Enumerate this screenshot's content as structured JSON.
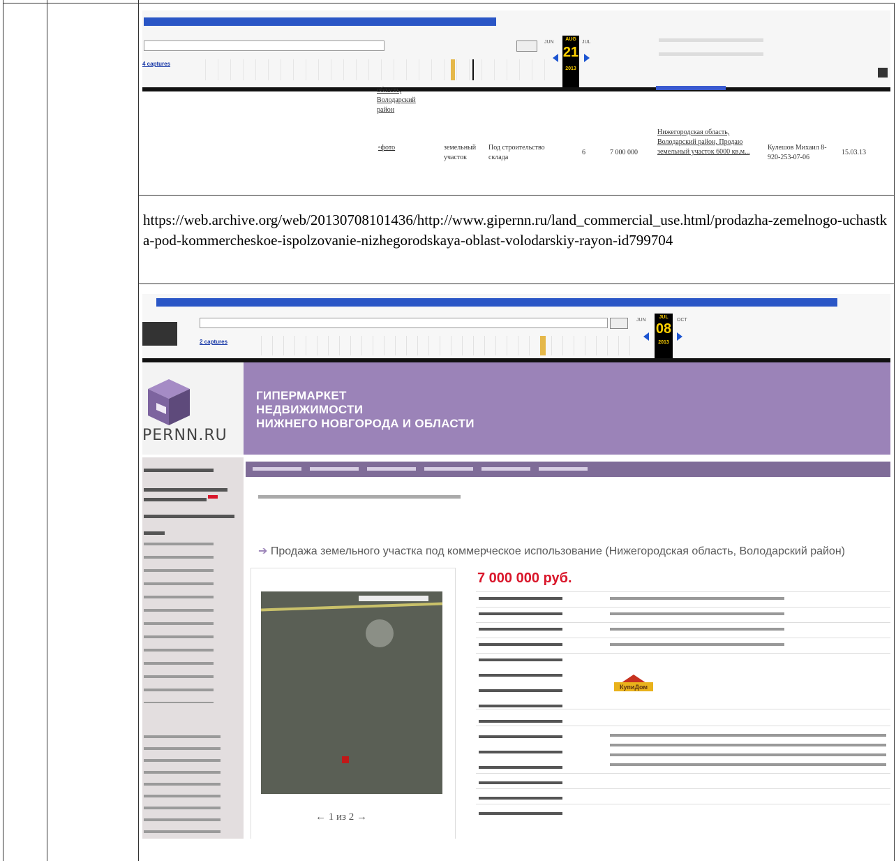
{
  "url_text": "https://web.archive.org/web/20130708101436/http://www.gipernn.ru/land_commercial_use.html/prodazha-zemelnogo-uchastka-pod-kommercheskoe-ispolzovanie-nizhegorodskaya-oblast-volodarskiy-rayon-id799704",
  "shot1": {
    "captures_label": "4 captures",
    "cal_left_month": "JUN",
    "cal_mid_month": "AUG",
    "cal_right_month": "JUL",
    "cal_day": "21",
    "cal_year": "2013",
    "fragment_text": "область, Володарский район",
    "listing": {
      "photo": "фото",
      "type": "земельный участок",
      "purpose": "Под строительство склада",
      "area": "6",
      "price": "7 000 000",
      "location": "Нижегородская область, Володарский район, Продаю земельный участок 6000 кв.м...",
      "contact": "Кулешов Михаил 8-920-253-07-06",
      "date": "15.03.13"
    }
  },
  "shot2": {
    "captures_label": "2 captures",
    "cal_left_month": "JUN",
    "cal_mid_month": "JUL",
    "cal_right_month": "OCT",
    "cal_day": "08",
    "cal_year": "2013",
    "logo_text": "PERNN.RU",
    "banner": {
      "line1": "ГИПЕРМАРКЕТ",
      "line2": "НЕДВИЖИМОСТИ",
      "line3": "НИЖНЕГО НОВГОРОДА И ОБЛАСТИ"
    },
    "heading": "Продажа земельного участка под коммерческое использование (Нижегородская область, Володарский район)",
    "price": "7 000 000 руб.",
    "pager": "← 1 из 2 →",
    "seller_logo": "КупиДом"
  }
}
